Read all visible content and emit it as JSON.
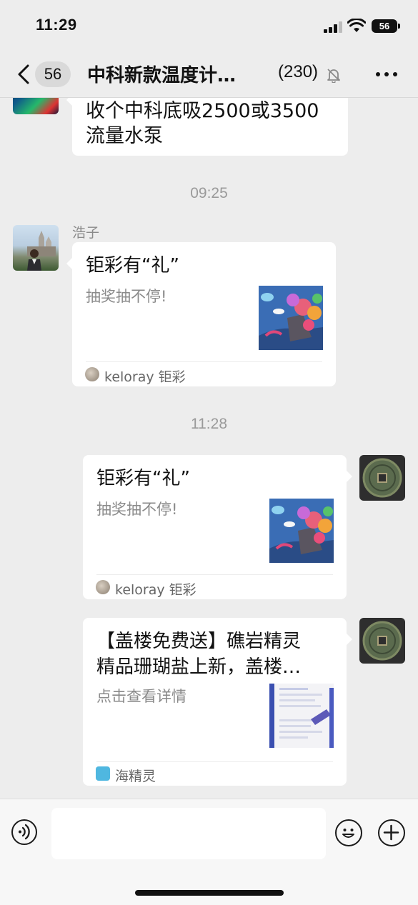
{
  "status_bar": {
    "time": "11:29",
    "battery": "56"
  },
  "nav": {
    "unread_count": "56",
    "title": "中科新款温度计…",
    "member_count": "(230)"
  },
  "messages": {
    "m1": {
      "text_line1": "收个中科底吸2500或3500",
      "text_line2": "流量水泵"
    },
    "ts1": "09:25",
    "m2": {
      "sender": "浩子",
      "card_title": "钜彩有“礼”",
      "card_desc": "抽奖抽不停!",
      "source": "keloray 钜彩"
    },
    "ts2": "11:28",
    "m3": {
      "card_title": "钜彩有“礼”",
      "card_desc": "抽奖抽不停!",
      "source": "keloray 钜彩"
    },
    "m4": {
      "card_title_line1": "【盖楼免费送】礁岩精灵",
      "card_title_line2": "精品珊瑚盐上新，盖楼…",
      "card_desc": "点击查看详情",
      "source": "海精灵"
    }
  },
  "input": {
    "value": "",
    "placeholder": ""
  },
  "icons": {
    "back": "chevron-left-icon",
    "mute": "bell-slash-icon",
    "more": "more-dots-icon",
    "voice": "voice-icon",
    "emoji": "emoji-icon",
    "plus": "plus-icon"
  },
  "colors": {
    "background": "#ededed",
    "bubble": "#ffffff",
    "timestamp": "#9a9a9a"
  }
}
